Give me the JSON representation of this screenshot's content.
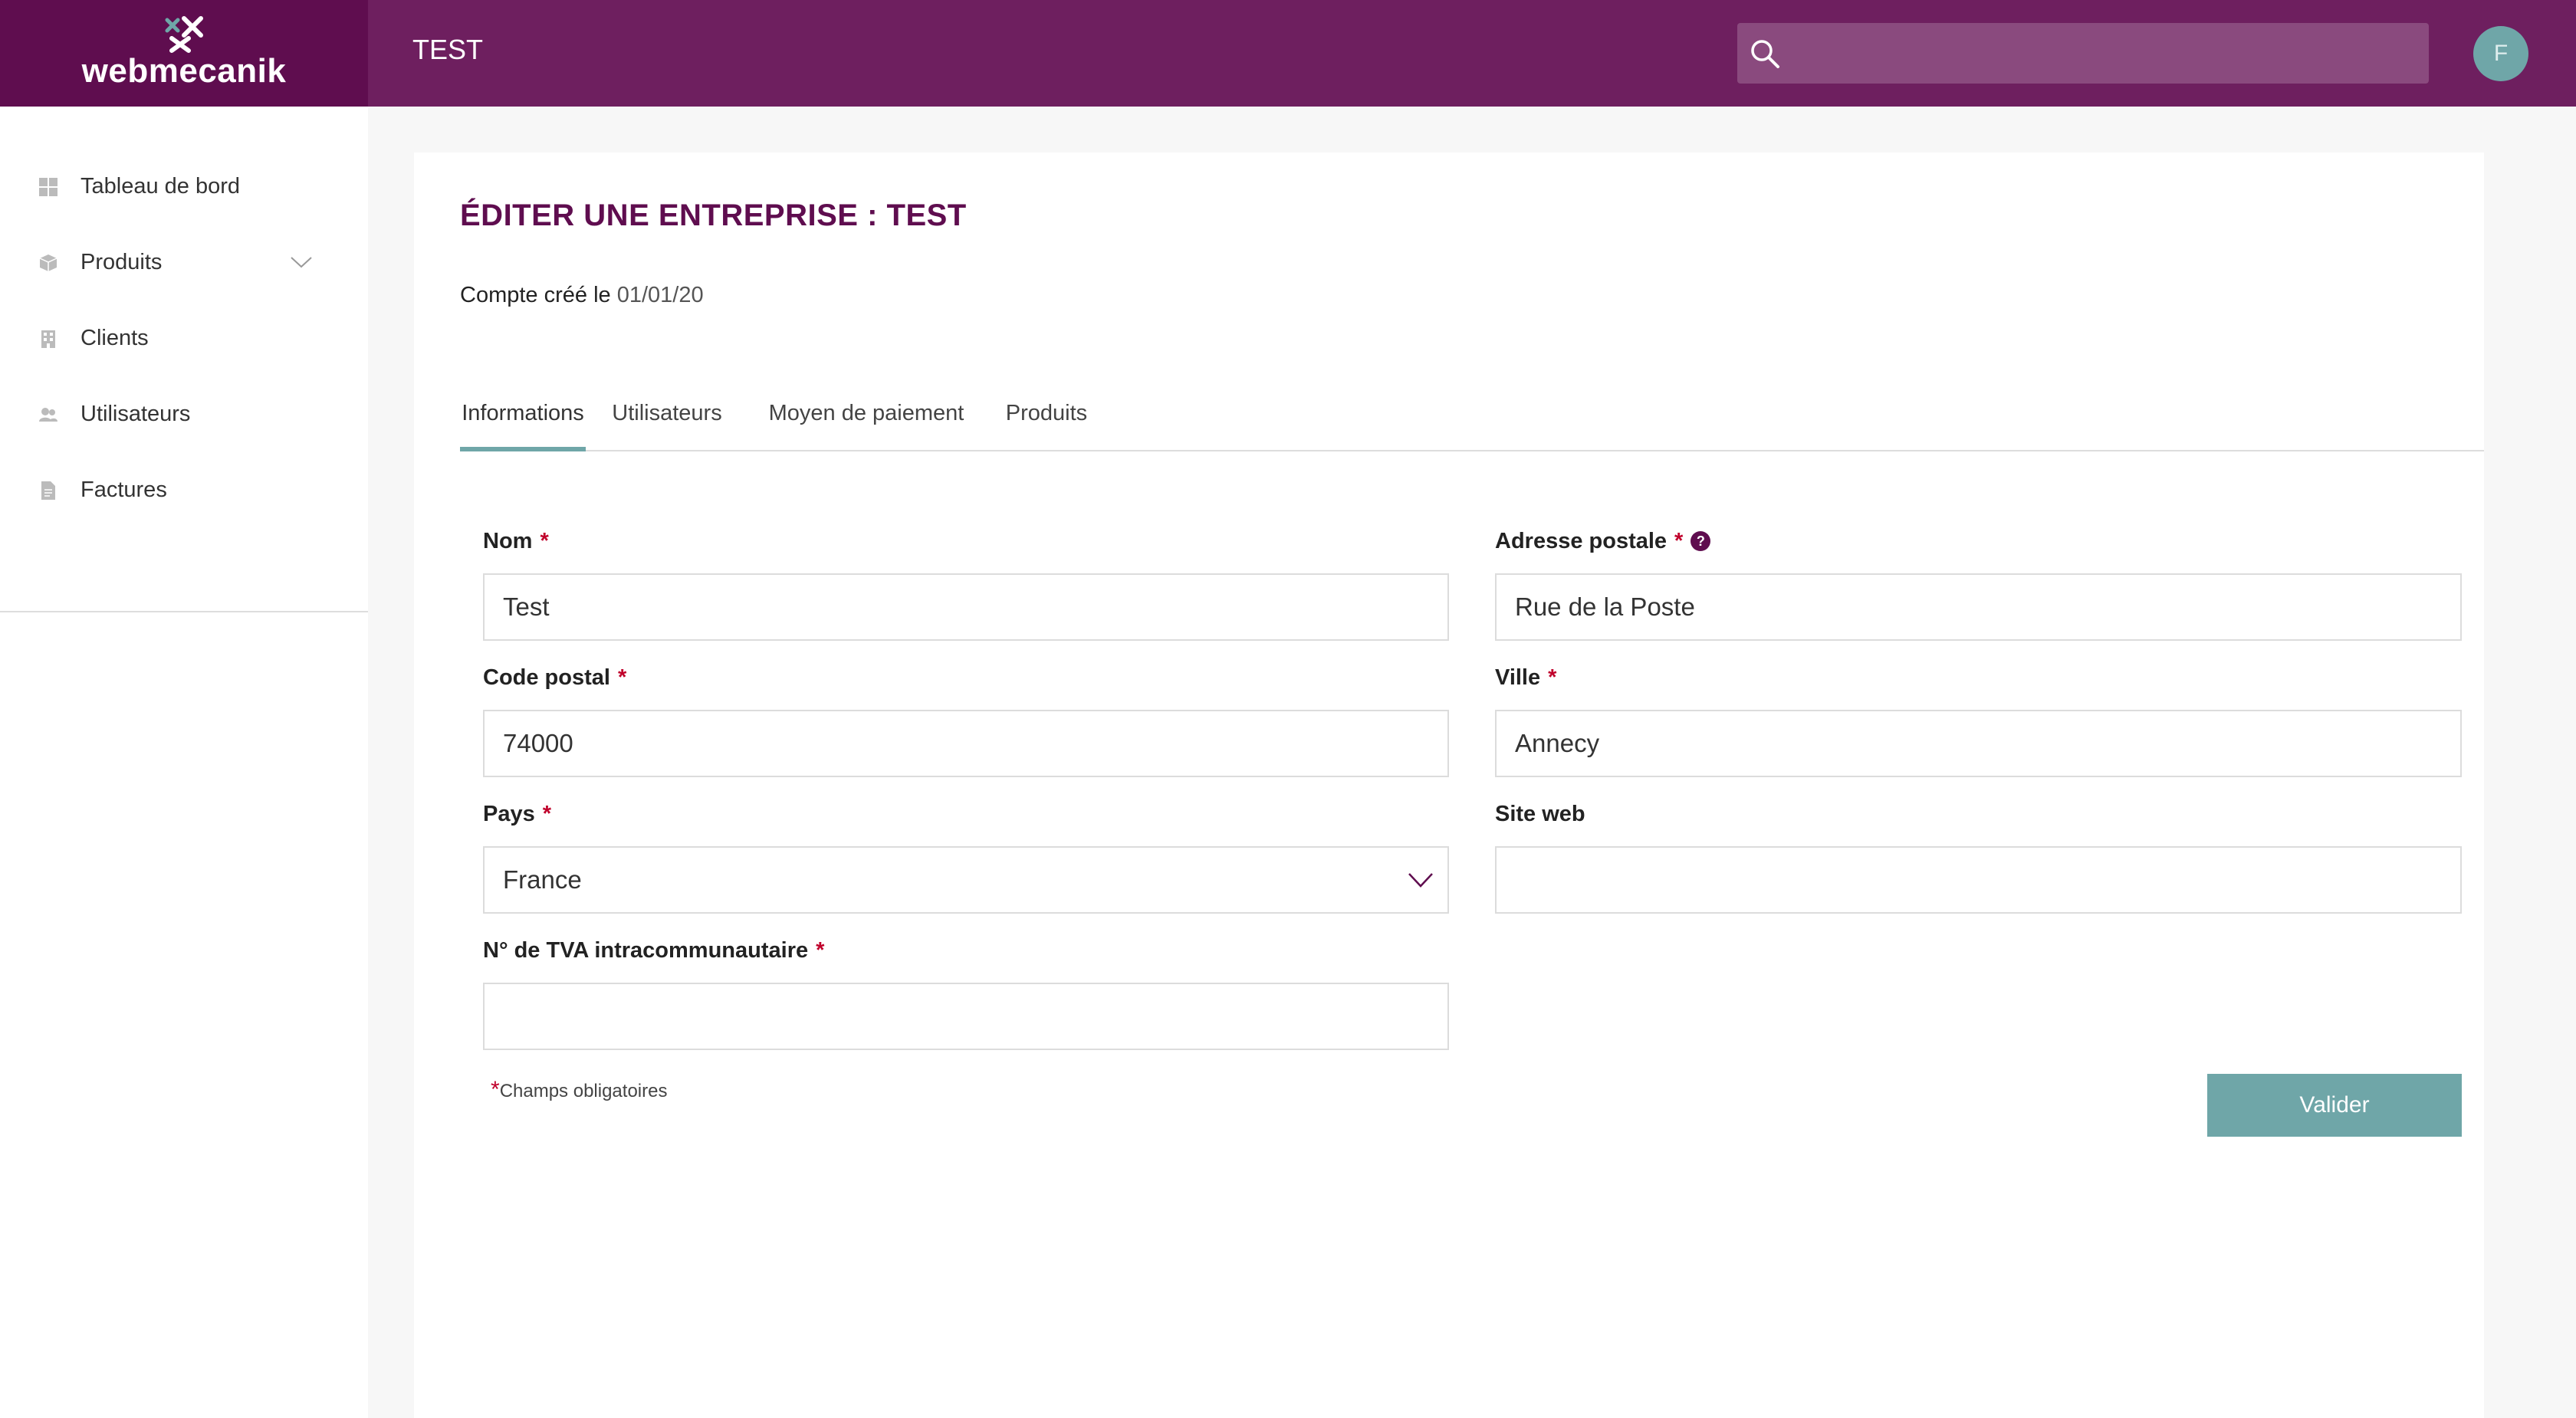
{
  "header": {
    "logo_text": "webmecanik",
    "page_label": "TEST",
    "search": {
      "placeholder": "",
      "icon": "search-icon"
    },
    "avatar_initial": "F"
  },
  "sidebar": {
    "items": [
      {
        "label": "Tableau de bord",
        "icon": "dashboard-icon"
      },
      {
        "label": "Produits",
        "icon": "box-icon",
        "has_chevron": true
      },
      {
        "label": "Clients",
        "icon": "building-icon"
      },
      {
        "label": "Utilisateurs",
        "icon": "users-icon"
      },
      {
        "label": "Factures",
        "icon": "document-icon"
      }
    ]
  },
  "main": {
    "title": "ÉDITER UNE ENTREPRISE : TEST",
    "created_label": "Compte créé le",
    "created_value": "01/01/20",
    "tabs": [
      {
        "label": "Informations",
        "active": true
      },
      {
        "label": "Utilisateurs",
        "active": false
      },
      {
        "label": "Moyen de paiement",
        "active": false
      },
      {
        "label": "Produits",
        "active": false
      }
    ],
    "form": {
      "nom": {
        "label": "Nom",
        "required": "*",
        "value": "Test"
      },
      "adresse": {
        "label": "Adresse postale",
        "required": "*",
        "value": "Rue de la Poste",
        "help": "?"
      },
      "code_postal": {
        "label": "Code postal",
        "required": "*",
        "value": "74000"
      },
      "ville": {
        "label": "Ville",
        "required": "*",
        "value": "Annecy"
      },
      "pays": {
        "label": "Pays",
        "required": "*",
        "value": "France"
      },
      "site_web": {
        "label": "Site web",
        "value": ""
      },
      "tva": {
        "label": "N° de TVA intracommunautaire",
        "required": "*",
        "value": ""
      },
      "mandatory_star": "*",
      "mandatory_note": "Champs obligatoires",
      "submit_label": "Valider"
    }
  },
  "colors": {
    "topbar": "#6e1f5f",
    "logo_bg": "#5f0d4f",
    "accent": "#6fa6a8",
    "title": "#5f0d4f",
    "required": "#c0002b"
  }
}
